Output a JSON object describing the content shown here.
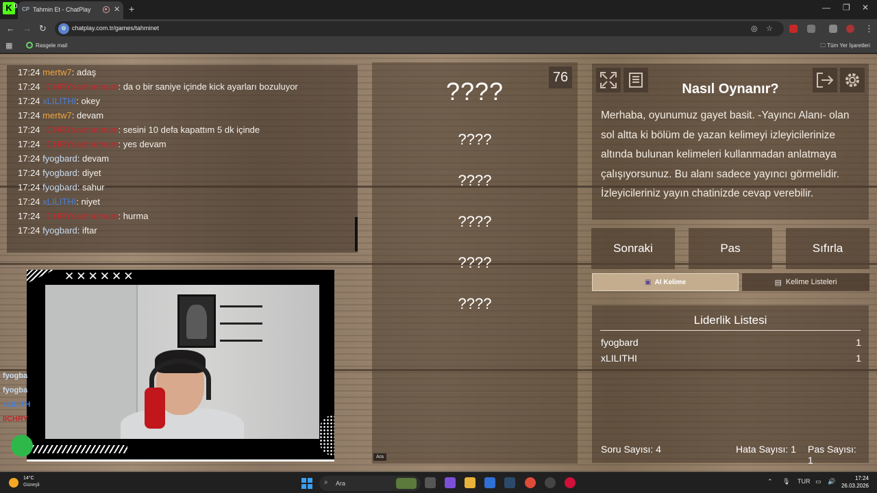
{
  "browser": {
    "tab_title": "Tahmin Et - ChatPlay",
    "tab_favicon": "CP",
    "corner_badge": "0",
    "url": "chatplay.com.tr/games/tahminet",
    "bookmark_item": "Rasgele mail",
    "bookmarks_all": "Tüm Yer İşaretleri"
  },
  "chat": {
    "messages": [
      {
        "time": "17:24",
        "user": "mertw7",
        "color": "#f0a53c",
        "text": ": adaş"
      },
      {
        "time": "17:24",
        "user": "llCHRYsanthemum",
        "color": "#c0282c",
        "text": ": da o bir saniye içinde kick ayarları bozuluyor"
      },
      {
        "time": "17:24",
        "user": "xLILITHI",
        "color": "#4a7ed6",
        "text": ": okey"
      },
      {
        "time": "17:24",
        "user": "mertw7",
        "color": "#f0a53c",
        "text": ": devam"
      },
      {
        "time": "17:24",
        "user": "llCHRYsanthemum",
        "color": "#c0282c",
        "text": ": sesini 10 defa kapattım 5 dk içinde"
      },
      {
        "time": "17:24",
        "user": "llCHRYsanthemum",
        "color": "#c0282c",
        "text": ": yes devam"
      },
      {
        "time": "17:24",
        "user": "fyogbard",
        "color": "#c9dcf2",
        "text": ": devam"
      },
      {
        "time": "17:24",
        "user": "fyogbard",
        "color": "#c9dcf2",
        "text": ": diyet"
      },
      {
        "time": "17:24",
        "user": "fyogbard",
        "color": "#c9dcf2",
        "text": ": sahur"
      },
      {
        "time": "17:24",
        "user": "xLILITHI",
        "color": "#4a7ed6",
        "text": ": niyet"
      },
      {
        "time": "17:24",
        "user": "llCHRYsanthemum",
        "color": "#c0282c",
        "text": ": hurma"
      },
      {
        "time": "17:24",
        "user": "fyogbard",
        "color": "#c9dcf2",
        "text": ": iftar"
      }
    ]
  },
  "overlay": {
    "cam_marks": "✕✕✕✕✕✕",
    "side_names": [
      {
        "name": "fyogba",
        "color": "#c9dcf2"
      },
      {
        "name": "fyogba",
        "color": "#c9dcf2"
      },
      {
        "name": "xLILITH",
        "color": "#4a7ed6"
      },
      {
        "name": "llCHRY",
        "color": "#c0282c"
      }
    ]
  },
  "game": {
    "timer": "76",
    "main_word": "????",
    "words": [
      "????",
      "????",
      "????",
      "????",
      "????"
    ],
    "search_tooltip": "Ara"
  },
  "howto": {
    "title": "Nasıl Oynanır?",
    "text": "Merhaba, oyunumuz gayet basit. -Yayıncı Alanı- olan sol altta ki bölüm de yazan kelimeyi izleyicilerinize altında bulunan kelimeleri kullanmadan anlatmaya çalışıyorsunuz. Bu alanı sadece yayıncı görmelidir. İzleyicileriniz yayın chatinizde cevap verebilir."
  },
  "actions": {
    "next": "Sonraki",
    "pass": "Pas",
    "reset": "Sıfırla"
  },
  "tabs": {
    "ai": "AI Kelime",
    "lists": "Kelime Listeleri"
  },
  "leaderboard": {
    "title": "Liderlik Listesi",
    "rows": [
      {
        "name": "fyogbard",
        "score": "1"
      },
      {
        "name": "xLILITHI",
        "score": "1"
      }
    ]
  },
  "stats": {
    "questions": "Soru Sayısı: 4",
    "errors": "Hata Sayısı: 1",
    "passes": "Pas Sayısı: 1"
  },
  "taskbar": {
    "temp": "14°C",
    "weather": "Güneşli",
    "search": "Ara",
    "lang": "TUR",
    "time": "17:24",
    "date": "26.03.2026"
  },
  "colors": {
    "accent_ai_tab": "#c4ad8f",
    "wood": "#8c7864",
    "kick_green": "#53fc18"
  }
}
